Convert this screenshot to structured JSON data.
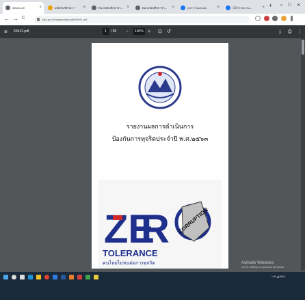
{
  "browser": {
    "tabs": [
      {
        "title": "65641.pdf",
        "icon_color": "#5f6368",
        "active": true
      },
      {
        "title": "ผลิตภัณฑ์ตัวถัง ฯ",
        "icon_color": "#e8a400",
        "active": false
      },
      {
        "title": "ศนกบหัตถศึกษาช่า...",
        "icon_color": "#5f6368",
        "active": false
      },
      {
        "title": "ศนกบหัตถศึกษาช่า...",
        "icon_color": "#5f6368",
        "active": false
      },
      {
        "title": "(20+) Facebook",
        "icon_color": "#1877f2",
        "active": false
      },
      {
        "title": "(20+) ผลงาน...",
        "icon_color": "#1877f2",
        "active": false
      }
    ],
    "new_tab": "+",
    "window_controls": {
      "minimize": "−",
      "maximize": "□",
      "close": "×"
    },
    "nav": {
      "back": "←",
      "forward": "→",
      "reload": "C"
    },
    "url": "ptpt.go.th/images/data/pdf/65641.pdf",
    "right_icons": [
      "star-icon",
      "menu-lines-icon",
      "extension-icon",
      "profile-icon",
      "kebab-icon"
    ]
  },
  "pdf_toolbar": {
    "menu": "≡",
    "filename": "65641.pdf",
    "page_current": "1",
    "page_total": "/ 86",
    "zoom_minus": "−",
    "zoom_value": "100%",
    "zoom_plus": "+",
    "fit": "⊡",
    "rotate": "↺",
    "download": "⤓",
    "print": "⎙",
    "more": "⋮"
  },
  "document": {
    "seal_text": "สถานพัฒนาฝีมือ แรงงาน",
    "title_line1": "รายงานผลการดำเนินการ",
    "title_line2": "ป้องกันการทุจริตประจำปี พ.ศ.๒๕๖๓",
    "poster": {
      "ze": "ZE",
      "r": "R",
      "o_text": "CORRUPTION",
      "tolerance": "TOLERANCE",
      "tagline": "คนไทยไม่ทนต่อการทุจริต"
    }
  },
  "activation": {
    "line1": "Activate Windows",
    "line2": "Go to Settings to activate Windows."
  },
  "taskbar": {
    "items": [
      {
        "name": "start-button",
        "color": "#4ea7e8"
      },
      {
        "name": "search-icon",
        "color": "#ddd"
      },
      {
        "name": "task-view-icon",
        "color": "#ddd"
      },
      {
        "name": "edge-icon",
        "color": "#1f8fd6"
      },
      {
        "name": "explorer-icon",
        "color": "#f3c12c"
      },
      {
        "name": "chrome-icon",
        "color": "#e34133"
      },
      {
        "name": "store-icon",
        "color": "#2d7be0"
      },
      {
        "name": "word-icon",
        "color": "#2b579a"
      },
      {
        "name": "app-icon-1",
        "color": "#e57f2f"
      },
      {
        "name": "app-icon-2",
        "color": "#cf3f3f"
      },
      {
        "name": "app-icon-3",
        "color": "#3fa34d"
      },
      {
        "name": "app-icon-4",
        "color": "#e8c93b"
      }
    ],
    "tray_text": "^ ✉ ◢ ENG"
  }
}
